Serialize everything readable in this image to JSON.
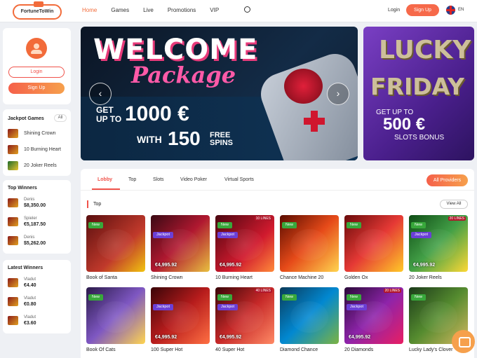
{
  "header": {
    "logo_text": "FortuneToWin",
    "nav": [
      "Home",
      "Games",
      "Live",
      "Promotions",
      "VIP"
    ],
    "login_label": "Login",
    "signup_label": "Sign Up",
    "lang": "EN"
  },
  "sidebar": {
    "login_label": "Login",
    "signup_label": "Sign Up",
    "jackpot_title": "Jackpot Games",
    "jackpot_all": "All",
    "jackpot_games": [
      "Shining Crown",
      "10 Burning Heart",
      "20 Joker Reels"
    ],
    "top_winners_title": "Top Winners",
    "top_winners": [
      {
        "name": "Denis",
        "amount": "$8,350.00"
      },
      {
        "name": "Spieler",
        "amount": "€5,187.50"
      },
      {
        "name": "Denis",
        "amount": "$5,262.00"
      }
    ],
    "latest_winners_title": "Latest Winners",
    "latest_winners": [
      {
        "name": "Vladut",
        "amount": "€4.40"
      },
      {
        "name": "Vladut",
        "amount": "€0.80"
      },
      {
        "name": "Vladut",
        "amount": "€3.60"
      }
    ]
  },
  "banner": {
    "title": "WELCOME",
    "subtitle": "Package",
    "get_up_to": "GET UP TO",
    "amount": "1000 €",
    "with": "WITH",
    "spins": "150",
    "free_spins": "FREE SPINS",
    "prev_arrow": "‹",
    "next_arrow": "›"
  },
  "banner2": {
    "line1": "LUCKY",
    "line2": "FRIDAY",
    "get_up_to": "GET UP TO",
    "amount": "500 €",
    "bonus": "SLOTS BONUS"
  },
  "tabs": [
    "Lobby",
    "Top",
    "Slots",
    "Video Poker",
    "Virtual Sports"
  ],
  "all_providers": "All Providers",
  "section": {
    "title": "Top",
    "view_all": "View All"
  },
  "games": [
    {
      "name": "Book of Santa",
      "badge": "New",
      "jackpot": "",
      "amount": "",
      "lines": ""
    },
    {
      "name": "Shining Crown",
      "badge": "",
      "jackpot": "Jackpot",
      "amount": "€4,995.92",
      "lines": ""
    },
    {
      "name": "10 Burning Heart",
      "badge": "New",
      "jackpot": "Jackpot",
      "amount": "€4,995.92",
      "lines": "10 LINES"
    },
    {
      "name": "Chance Machine 20",
      "badge": "New",
      "jackpot": "",
      "amount": "",
      "lines": ""
    },
    {
      "name": "Golden Ox",
      "badge": "New",
      "jackpot": "",
      "amount": "",
      "lines": ""
    },
    {
      "name": "20 Joker Reels",
      "badge": "New",
      "jackpot": "Jackpot",
      "amount": "€4,995.92",
      "lines": "20 LINES"
    },
    {
      "name": "Book Of Cats",
      "badge": "New",
      "jackpot": "",
      "amount": "",
      "lines": ""
    },
    {
      "name": "100 Super Hot",
      "badge": "",
      "jackpot": "Jackpot",
      "amount": "€4,995.92",
      "lines": ""
    },
    {
      "name": "40 Super Hot",
      "badge": "New",
      "jackpot": "Jackpot",
      "amount": "€4,995.92",
      "lines": "40 LINES"
    },
    {
      "name": "Diamond Chance",
      "badge": "New",
      "jackpot": "",
      "amount": "",
      "lines": ""
    },
    {
      "name": "20 Diamonds",
      "badge": "New",
      "jackpot": "Jackpot",
      "amount": "€4,995.92",
      "lines": "20 LINES"
    },
    {
      "name": "Lucky Lady's Clover",
      "badge": "New",
      "jackpot": "",
      "amount": "",
      "lines": ""
    }
  ]
}
